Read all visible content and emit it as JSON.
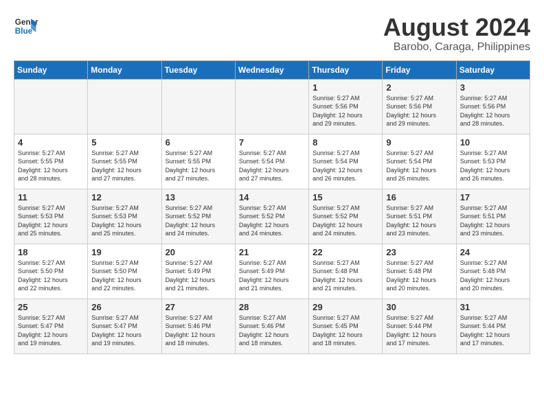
{
  "logo": {
    "line1": "General",
    "line2": "Blue"
  },
  "title": {
    "month_year": "August 2024",
    "location": "Barobo, Caraga, Philippines"
  },
  "days_of_week": [
    "Sunday",
    "Monday",
    "Tuesday",
    "Wednesday",
    "Thursday",
    "Friday",
    "Saturday"
  ],
  "weeks": [
    [
      {
        "day": "",
        "info": ""
      },
      {
        "day": "",
        "info": ""
      },
      {
        "day": "",
        "info": ""
      },
      {
        "day": "",
        "info": ""
      },
      {
        "day": "1",
        "info": "Sunrise: 5:27 AM\nSunset: 5:56 PM\nDaylight: 12 hours\nand 29 minutes."
      },
      {
        "day": "2",
        "info": "Sunrise: 5:27 AM\nSunset: 5:56 PM\nDaylight: 12 hours\nand 29 minutes."
      },
      {
        "day": "3",
        "info": "Sunrise: 5:27 AM\nSunset: 5:56 PM\nDaylight: 12 hours\nand 28 minutes."
      }
    ],
    [
      {
        "day": "4",
        "info": "Sunrise: 5:27 AM\nSunset: 5:55 PM\nDaylight: 12 hours\nand 28 minutes."
      },
      {
        "day": "5",
        "info": "Sunrise: 5:27 AM\nSunset: 5:55 PM\nDaylight: 12 hours\nand 27 minutes."
      },
      {
        "day": "6",
        "info": "Sunrise: 5:27 AM\nSunset: 5:55 PM\nDaylight: 12 hours\nand 27 minutes."
      },
      {
        "day": "7",
        "info": "Sunrise: 5:27 AM\nSunset: 5:54 PM\nDaylight: 12 hours\nand 27 minutes."
      },
      {
        "day": "8",
        "info": "Sunrise: 5:27 AM\nSunset: 5:54 PM\nDaylight: 12 hours\nand 26 minutes."
      },
      {
        "day": "9",
        "info": "Sunrise: 5:27 AM\nSunset: 5:54 PM\nDaylight: 12 hours\nand 26 minutes."
      },
      {
        "day": "10",
        "info": "Sunrise: 5:27 AM\nSunset: 5:53 PM\nDaylight: 12 hours\nand 26 minutes."
      }
    ],
    [
      {
        "day": "11",
        "info": "Sunrise: 5:27 AM\nSunset: 5:53 PM\nDaylight: 12 hours\nand 25 minutes."
      },
      {
        "day": "12",
        "info": "Sunrise: 5:27 AM\nSunset: 5:53 PM\nDaylight: 12 hours\nand 25 minutes."
      },
      {
        "day": "13",
        "info": "Sunrise: 5:27 AM\nSunset: 5:52 PM\nDaylight: 12 hours\nand 24 minutes."
      },
      {
        "day": "14",
        "info": "Sunrise: 5:27 AM\nSunset: 5:52 PM\nDaylight: 12 hours\nand 24 minutes."
      },
      {
        "day": "15",
        "info": "Sunrise: 5:27 AM\nSunset: 5:52 PM\nDaylight: 12 hours\nand 24 minutes."
      },
      {
        "day": "16",
        "info": "Sunrise: 5:27 AM\nSunset: 5:51 PM\nDaylight: 12 hours\nand 23 minutes."
      },
      {
        "day": "17",
        "info": "Sunrise: 5:27 AM\nSunset: 5:51 PM\nDaylight: 12 hours\nand 23 minutes."
      }
    ],
    [
      {
        "day": "18",
        "info": "Sunrise: 5:27 AM\nSunset: 5:50 PM\nDaylight: 12 hours\nand 22 minutes."
      },
      {
        "day": "19",
        "info": "Sunrise: 5:27 AM\nSunset: 5:50 PM\nDaylight: 12 hours\nand 22 minutes."
      },
      {
        "day": "20",
        "info": "Sunrise: 5:27 AM\nSunset: 5:49 PM\nDaylight: 12 hours\nand 21 minutes."
      },
      {
        "day": "21",
        "info": "Sunrise: 5:27 AM\nSunset: 5:49 PM\nDaylight: 12 hours\nand 21 minutes."
      },
      {
        "day": "22",
        "info": "Sunrise: 5:27 AM\nSunset: 5:48 PM\nDaylight: 12 hours\nand 21 minutes."
      },
      {
        "day": "23",
        "info": "Sunrise: 5:27 AM\nSunset: 5:48 PM\nDaylight: 12 hours\nand 20 minutes."
      },
      {
        "day": "24",
        "info": "Sunrise: 5:27 AM\nSunset: 5:48 PM\nDaylight: 12 hours\nand 20 minutes."
      }
    ],
    [
      {
        "day": "25",
        "info": "Sunrise: 5:27 AM\nSunset: 5:47 PM\nDaylight: 12 hours\nand 19 minutes."
      },
      {
        "day": "26",
        "info": "Sunrise: 5:27 AM\nSunset: 5:47 PM\nDaylight: 12 hours\nand 19 minutes."
      },
      {
        "day": "27",
        "info": "Sunrise: 5:27 AM\nSunset: 5:46 PM\nDaylight: 12 hours\nand 18 minutes."
      },
      {
        "day": "28",
        "info": "Sunrise: 5:27 AM\nSunset: 5:46 PM\nDaylight: 12 hours\nand 18 minutes."
      },
      {
        "day": "29",
        "info": "Sunrise: 5:27 AM\nSunset: 5:45 PM\nDaylight: 12 hours\nand 18 minutes."
      },
      {
        "day": "30",
        "info": "Sunrise: 5:27 AM\nSunset: 5:44 PM\nDaylight: 12 hours\nand 17 minutes."
      },
      {
        "day": "31",
        "info": "Sunrise: 5:27 AM\nSunset: 5:44 PM\nDaylight: 12 hours\nand 17 minutes."
      }
    ]
  ]
}
